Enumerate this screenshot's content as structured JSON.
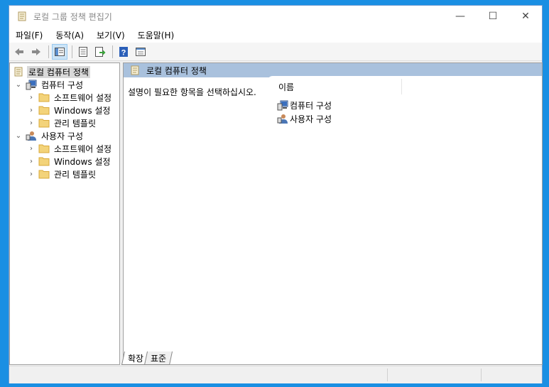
{
  "window": {
    "title": "로컬 그룹 정책 편집기",
    "controls": {
      "minimize": "—",
      "maximize": "☐",
      "close": "✕"
    }
  },
  "menu": [
    {
      "label": "파일(F)"
    },
    {
      "label": "동작(A)"
    },
    {
      "label": "보기(V)"
    },
    {
      "label": "도움말(H)"
    }
  ],
  "toolbar": {
    "buttons": [
      "back-arrow-icon",
      "forward-arrow-icon",
      "show-hide-tree-icon",
      "properties-icon",
      "export-list-icon",
      "help-icon",
      "view-icon"
    ]
  },
  "tree": {
    "root": "로컬 컴퓨터 정책",
    "computer": "컴퓨터 구성",
    "computer_children": [
      "소프트웨어 설정",
      "Windows 설정",
      "관리 템플릿"
    ],
    "user": "사용자 구성",
    "user_children": [
      "소프트웨어 설정",
      "Windows 설정",
      "관리 템플릿"
    ]
  },
  "main": {
    "header": "로컬 컴퓨터 정책",
    "description": "설명이 필요한 항목을 선택하십시오.",
    "column_name": "이름",
    "items": [
      "컴퓨터 구성",
      "사용자 구성"
    ]
  },
  "tabs": [
    {
      "label": "확장",
      "active": true
    },
    {
      "label": "표준",
      "active": false
    }
  ],
  "colors": {
    "accent": "#a9c1dd",
    "desktop": "#1a8fe3"
  }
}
